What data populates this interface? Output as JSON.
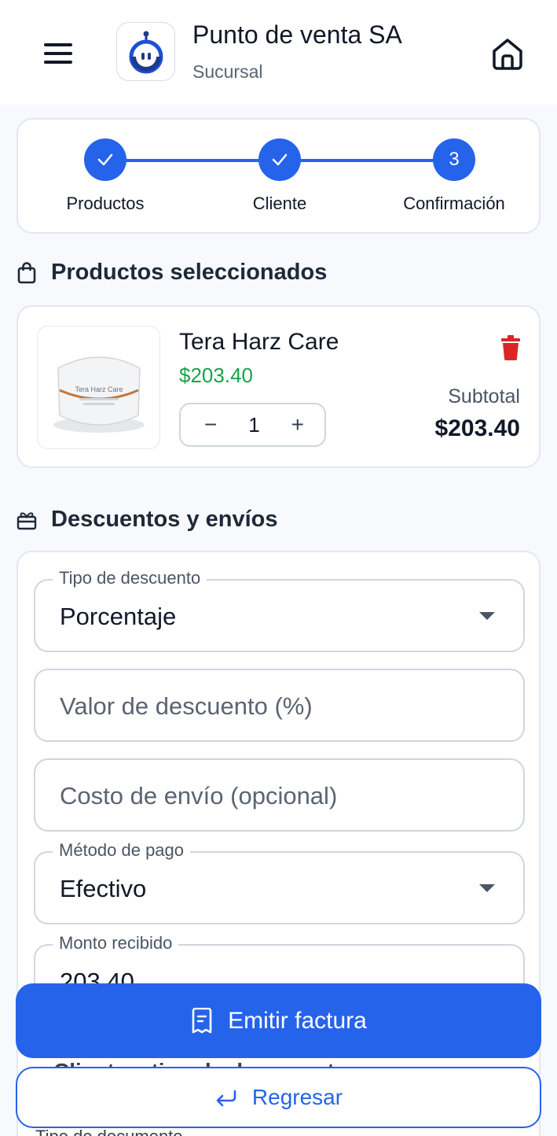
{
  "header": {
    "title": "Punto de venta SA",
    "subtitle": "Sucursal"
  },
  "stepper": {
    "steps": [
      {
        "label": "Productos",
        "state": "done"
      },
      {
        "label": "Cliente",
        "state": "done"
      },
      {
        "label": "Confirmación",
        "state": "current",
        "number": "3"
      }
    ]
  },
  "products_section": {
    "title": "Productos seleccionados",
    "item": {
      "name": "Tera Harz Care",
      "price": "$203.40",
      "quantity": "1",
      "subtotal_label": "Subtotal",
      "subtotal_value": "$203.40",
      "image_label": "Tera Harz Care"
    }
  },
  "discounts_section": {
    "title": "Descuentos y envíos",
    "discount_type": {
      "label": "Tipo de descuento",
      "value": "Porcentaje"
    },
    "discount_value": {
      "placeholder": "Valor de descuento (%)"
    },
    "shipping_cost": {
      "placeholder": "Costo de envío (opcional)"
    },
    "payment_method": {
      "label": "Método de pago",
      "value": "Efectivo"
    },
    "amount_received": {
      "label": "Monto recibido",
      "value": "203.40"
    }
  },
  "partially_hidden": {
    "next_section": "Cliente y tipo de documento",
    "next_field_label": "Tipo de documento"
  },
  "actions": {
    "issue_invoice": "Emitir factura",
    "back": "Regresar"
  },
  "colors": {
    "primary": "#2563eb",
    "price_green": "#16a34a",
    "danger": "#dc2626"
  }
}
